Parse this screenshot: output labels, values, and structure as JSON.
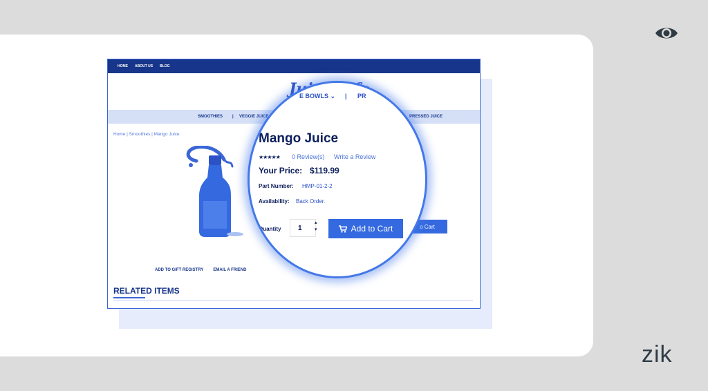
{
  "site": {
    "topnav": [
      "HOME",
      "ABOUT US",
      "BLOG"
    ],
    "logo": "Juice Life",
    "subnav_partial": [
      "E BOWLS ⌄",
      "|",
      "PR"
    ],
    "mainnav": [
      "SMOOTHIES",
      "|",
      "VEGGIE JUICE",
      "PRESSED JUICE"
    ],
    "breadcrumb": "Home | Smoothies | Mango Juice",
    "links": {
      "gift": "ADD TO GIFT REGISTRY",
      "email": "EMAIL A FRIEND"
    },
    "related": "RELATED ITEMS",
    "bg_cart_partial": "o Cart"
  },
  "product": {
    "title": "Mango Juice",
    "stars": "★★★★★",
    "reviews": "0 Review(s)",
    "write_review": "Write a Review",
    "price_label": "Your Price:",
    "price": "$119.99",
    "part_label": "Part Number:",
    "part_number": "HMP-01-2-2",
    "availability_label": "Availability:",
    "availability": "Back Order.",
    "quantity_label": "Quantity",
    "quantity": "1",
    "add_to_cart": "Add to Cart"
  },
  "brand": "zik",
  "colors": {
    "primary": "#3469e0",
    "dark": "#0c1f5c",
    "nav": "#17358a"
  }
}
